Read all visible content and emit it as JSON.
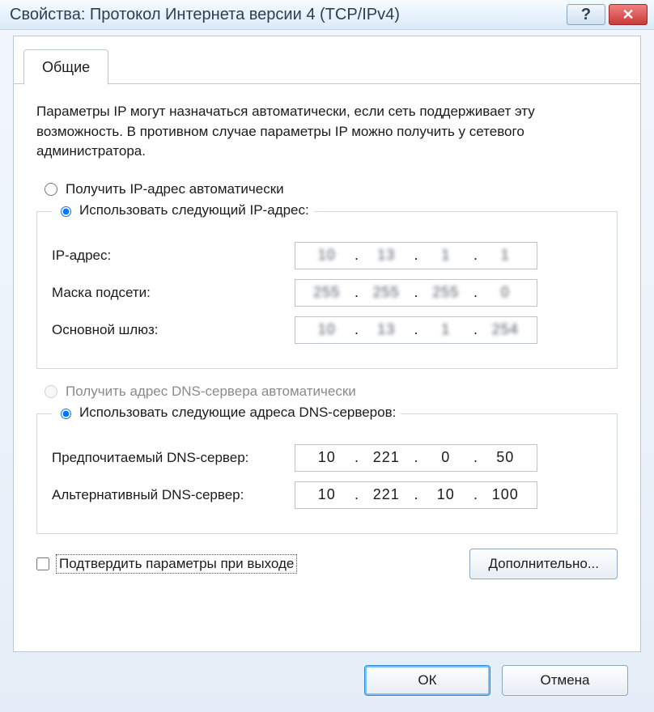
{
  "window": {
    "title": "Свойства: Протокол Интернета версии 4 (TCP/IPv4)",
    "help_glyph": "?",
    "close_glyph": "✕"
  },
  "tab": {
    "label": "Общие"
  },
  "intro": "Параметры IP могут назначаться автоматически, если сеть поддерживает эту возможность. В противном случае параметры IP можно получить у сетевого администратора.",
  "ip": {
    "auto_label": "Получить IP-адрес автоматически",
    "manual_label": "Использовать следующий IP-адрес:",
    "auto_selected": false,
    "fields": {
      "address_label": "IP-адрес:",
      "mask_label": "Маска подсети:",
      "gateway_label": "Основной шлюз:",
      "address": [
        "10",
        "13",
        "1",
        "1"
      ],
      "mask": [
        "255",
        "255",
        "255",
        "0"
      ],
      "gateway": [
        "10",
        "13",
        "1",
        "254"
      ]
    }
  },
  "dns": {
    "auto_label": "Получить адрес DNS-сервера автоматически",
    "manual_label": "Использовать следующие адреса DNS-серверов:",
    "auto_enabled": false,
    "auto_selected": false,
    "fields": {
      "preferred_label": "Предпочитаемый DNS-сервер:",
      "alternate_label": "Альтернативный DNS-сервер:",
      "preferred": [
        "10",
        "221",
        "0",
        "50"
      ],
      "alternate": [
        "10",
        "221",
        "10",
        "100"
      ]
    }
  },
  "validate": {
    "label": "Подтвердить параметры при выходе",
    "checked": false
  },
  "buttons": {
    "advanced": "Дополнительно...",
    "ok": "ОК",
    "cancel": "Отмена"
  }
}
